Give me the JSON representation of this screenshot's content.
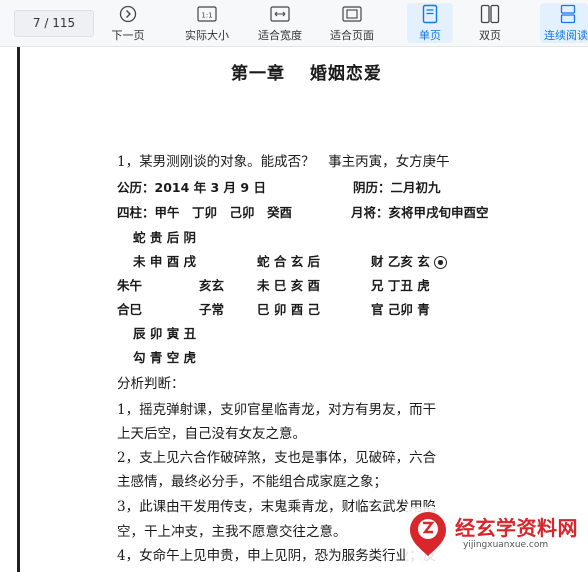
{
  "toolbar": {
    "page_indicator": "7 / 115",
    "buttons": [
      {
        "label": "下一页",
        "icon": "next-page-icon"
      },
      {
        "label": "实际大小",
        "icon": "actual-size-icon"
      },
      {
        "label": "适合宽度",
        "icon": "fit-width-icon"
      },
      {
        "label": "适合页面",
        "icon": "fit-page-icon"
      },
      {
        "label": "单页",
        "icon": "single-page-icon",
        "active": true
      },
      {
        "label": "双页",
        "icon": "double-page-icon"
      },
      {
        "label": "连续阅读",
        "icon": "continuous-read-icon",
        "active": true
      }
    ],
    "accent_color": "#1677e8"
  },
  "document": {
    "chapter_title": "第一章　 婚姻恋爱",
    "lines": [
      "1，某男测刚谈的对象。能成否？　事主丙寅，女方庚午",
      "公历：2014 年 3 月 9 日",
      "阴历：二月初九",
      "四柱：甲午　丁卯　己卯　癸酉",
      "月将：亥将甲戌旬申酉空",
      "蛇 贵 后 阴",
      "未 申 酉 戌",
      "蛇 合 玄 后",
      "财 乙亥 玄",
      "朱午",
      "亥玄",
      "未 巳 亥 酉",
      "兄 丁丑 虎",
      "合巳",
      "子常",
      "巳 卯 酉 己",
      "官 己卯 青",
      "辰 卯 寅 丑",
      "勾 青 空 虎",
      "分析判断：",
      "1，摇克弹射课，支卯官星临青龙，对方有男友，而干",
      "上天后空，自己没有女友之意。",
      "2，支上见六合作破碎煞，支也是事体，见破碎，六合",
      "主感情，最终必分手，不能组合成家庭之象；",
      "3，此课由干发用传支，末鬼乘青龙，财临玄武发用陷",
      "空，干上冲支，主我不愿意交往之意。",
      "4，女命午上见申贵，申上见阴，恐为服务类行业；反"
    ]
  },
  "watermark": {
    "name": "经玄学资料网",
    "url": "yijingxuanxue.com"
  }
}
